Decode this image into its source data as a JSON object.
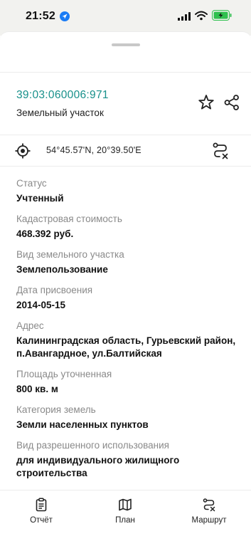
{
  "status_bar": {
    "time": "21:52"
  },
  "object": {
    "cadastral_number": "39:03:060006:971",
    "type": "Земельный участок",
    "coordinates": "54°45.57'N, 20°39.50'E"
  },
  "fields": [
    {
      "label": "Статус",
      "value": "Учтенный"
    },
    {
      "label": "Кадастровая стоимость",
      "value": "468.392 руб."
    },
    {
      "label": "Вид земельного участка",
      "value": "Землепользование"
    },
    {
      "label": "Дата присвоения",
      "value": "2014-05-15"
    },
    {
      "label": "Адрес",
      "value": "Калининградская область, Гурьевский район, п.Авангардное, ул.Балтийская"
    },
    {
      "label": "Площадь уточненная",
      "value": "800 кв. м"
    },
    {
      "label": "Категория земель",
      "value": "Земли населенных пунктов"
    },
    {
      "label": "Вид разрешенного использования",
      "value": "для индивидуального жилищного строительства"
    }
  ],
  "tabs": [
    {
      "label": "Отчёт",
      "icon": "clipboard-icon"
    },
    {
      "label": "План",
      "icon": "map-icon"
    },
    {
      "label": "Маршрут",
      "icon": "route-icon"
    }
  ],
  "colors": {
    "accent": "#17908a",
    "label": "#8a8a8a",
    "battery": "#30c04f"
  }
}
